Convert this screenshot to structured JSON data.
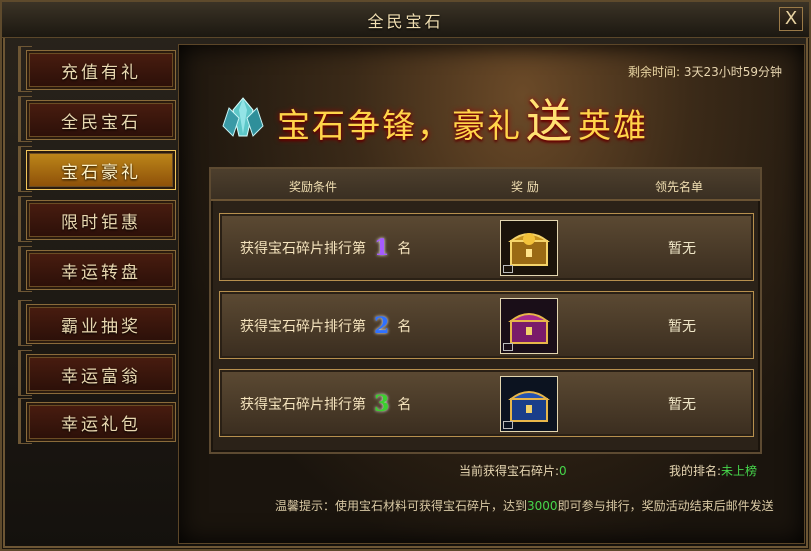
{
  "window": {
    "title": "全民宝石",
    "close_label": "X"
  },
  "sidebar": {
    "items": [
      {
        "label": "充值有礼",
        "active": false
      },
      {
        "label": "全民宝石",
        "active": false
      },
      {
        "label": "宝石豪礼",
        "active": true
      },
      {
        "label": "限时钜惠",
        "active": false
      },
      {
        "label": "幸运转盘",
        "active": false
      },
      {
        "label": "霸业抽奖",
        "active": false
      },
      {
        "label": "幸运富翁",
        "active": false
      },
      {
        "label": "幸运礼包",
        "active": false
      }
    ]
  },
  "main": {
    "remaining_time": {
      "label": "剩余时间:",
      "value": "3天23小时59分钟"
    },
    "banner": {
      "part1": "宝石争锋，豪礼",
      "emphasis": "送",
      "part2": "英雄"
    },
    "table": {
      "headers": {
        "condition": "奖励条件",
        "reward": "奖 励",
        "leaders": "领先名单"
      },
      "rows": [
        {
          "prefix": "获得宝石碎片排行第",
          "rank": "1",
          "suffix": "名",
          "leader": "暂无",
          "chest": "gold-dragon-chest"
        },
        {
          "prefix": "获得宝石碎片排行第",
          "rank": "2",
          "suffix": "名",
          "leader": "暂无",
          "chest": "purple-chest"
        },
        {
          "prefix": "获得宝石碎片排行第",
          "rank": "3",
          "suffix": "名",
          "leader": "暂无",
          "chest": "blue-chest"
        }
      ]
    },
    "status": {
      "fragments_label": "当前获得宝石碎片:",
      "fragments_value": "0",
      "my_rank_label": "我的排名:",
      "my_rank_value": "未上榜"
    },
    "tip": {
      "prefix": "温馨提示：使用宝石材料可获得宝石碎片，达到",
      "highlight": "3000",
      "suffix": "即可参与排行，奖励活动结束后邮件发送"
    }
  },
  "colors": {
    "accent_gold": "#ffd54a",
    "highlight_green": "#46d64b",
    "rank1": "#a55bff",
    "rank2": "#2f71ff",
    "rank3": "#3ccf2f"
  }
}
